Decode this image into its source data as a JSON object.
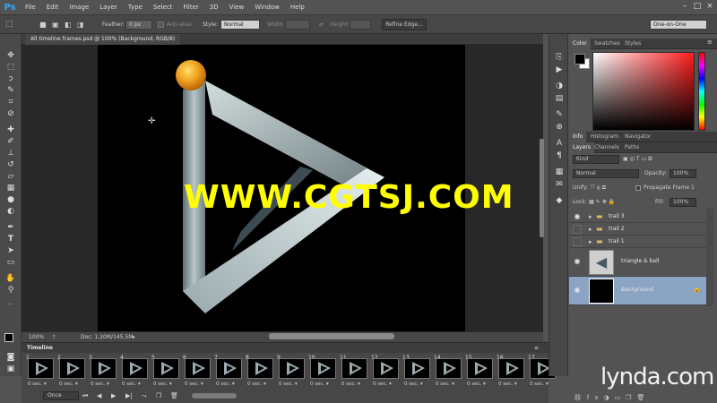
{
  "app": {
    "logo": "Ps"
  },
  "menu": [
    "File",
    "Edit",
    "Image",
    "Layer",
    "Type",
    "Select",
    "Filter",
    "3D",
    "View",
    "Window",
    "Help"
  ],
  "options_bar": {
    "feather_label": "Feather:",
    "feather_value": "0 px",
    "antialias_label": "Anti-alias",
    "style_label": "Style:",
    "style_value": "Normal",
    "width_label": "Width:",
    "height_label": "Height:",
    "refine_edge_label": "Refine Edge...",
    "workspace_value": "One-on-One"
  },
  "document": {
    "tab_title": "All timeline frames.psd @ 100% (Background, RGB/8)",
    "zoom": "100%",
    "doc_info": "Doc: 1.20M/145.5M"
  },
  "watermark": "WWW.CGTSJ.COM",
  "panels": {
    "color_tabs": [
      "Color",
      "Swatches",
      "Styles"
    ],
    "info_tabs": [
      "Info",
      "Histogram",
      "Navigator"
    ],
    "layers_tabs": [
      "Layers",
      "Channels",
      "Paths"
    ],
    "filter_kind": "Kind",
    "blend_mode": "Normal",
    "opacity_label": "Opacity:",
    "opacity_value": "100%",
    "unify_label": "Unify:",
    "propagate_label": "Propagate Frame 1",
    "lock_label": "Lock:",
    "fill_label": "Fill:",
    "fill_value": "100%",
    "layers": [
      {
        "name": "trail 3",
        "type": "group",
        "visible": true
      },
      {
        "name": "trail 2",
        "type": "group",
        "visible": false
      },
      {
        "name": "trail 1",
        "type": "group",
        "visible": false
      },
      {
        "name": "triangle & ball",
        "type": "layer",
        "visible": true
      },
      {
        "name": "Background",
        "type": "background",
        "visible": true,
        "locked": true
      }
    ]
  },
  "timeline": {
    "title": "Timeline",
    "loop_value": "Once",
    "frames": [
      {
        "num": "1",
        "delay": "0 sec."
      },
      {
        "num": "2",
        "delay": "0 sec."
      },
      {
        "num": "3",
        "delay": "0 sec."
      },
      {
        "num": "4",
        "delay": "0 sec."
      },
      {
        "num": "5",
        "delay": "0 sec."
      },
      {
        "num": "6",
        "delay": "0 sec."
      },
      {
        "num": "7",
        "delay": "0 sec."
      },
      {
        "num": "8",
        "delay": "0 sec."
      },
      {
        "num": "9",
        "delay": "0 sec."
      },
      {
        "num": "10",
        "delay": "0 sec."
      },
      {
        "num": "11",
        "delay": "0 sec."
      },
      {
        "num": "12",
        "delay": "0 sec."
      },
      {
        "num": "13",
        "delay": "0 sec."
      },
      {
        "num": "14",
        "delay": "0 sec."
      },
      {
        "num": "15",
        "delay": "0 sec."
      },
      {
        "num": "16",
        "delay": "0 sec."
      },
      {
        "num": "17",
        "delay": "0 sec."
      }
    ]
  },
  "brand_watermark": "lynda.com",
  "colors": {
    "accent": "#31a8ff",
    "watermark": "#ffff00",
    "selected_layer": "#8ba4c3"
  }
}
